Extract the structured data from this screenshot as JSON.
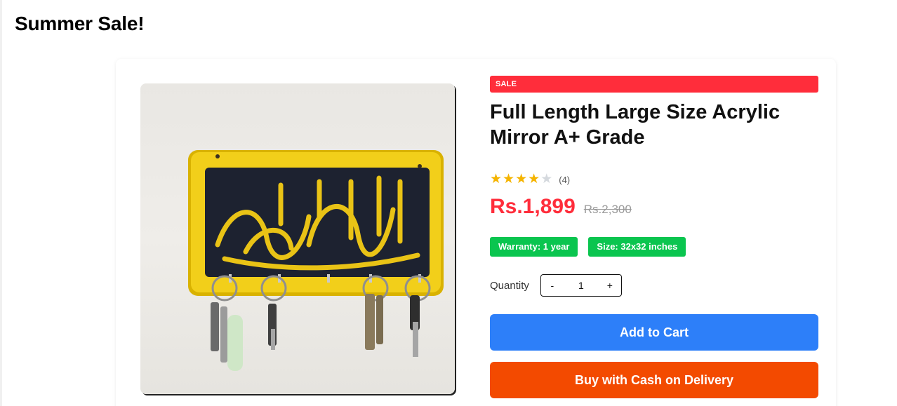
{
  "page": {
    "title": "Summer Sale!"
  },
  "product": {
    "badge": "SALE",
    "name": "Full Length Large Size Acrylic Mirror A+ Grade",
    "image_icon": "key-holder-image",
    "rating": {
      "value": 4,
      "max": 5,
      "count_label": "(4)"
    },
    "price": "Rs.1,899",
    "old_price": "Rs.2,300",
    "tags": [
      "Warranty: 1 year",
      "Size: 32x32 inches"
    ],
    "quantity": {
      "label": "Quantity",
      "decrement": "-",
      "value": "1",
      "increment": "+"
    },
    "actions": {
      "add_to_cart": "Add to Cart",
      "buy_cod": "Buy with Cash on Delivery"
    }
  },
  "colors": {
    "sale_red": "#ff2d3b",
    "tag_green": "#0ac54f",
    "cart_blue": "#2d7ff9",
    "cod_orange": "#f34a00",
    "star_gold": "#f5b400"
  }
}
